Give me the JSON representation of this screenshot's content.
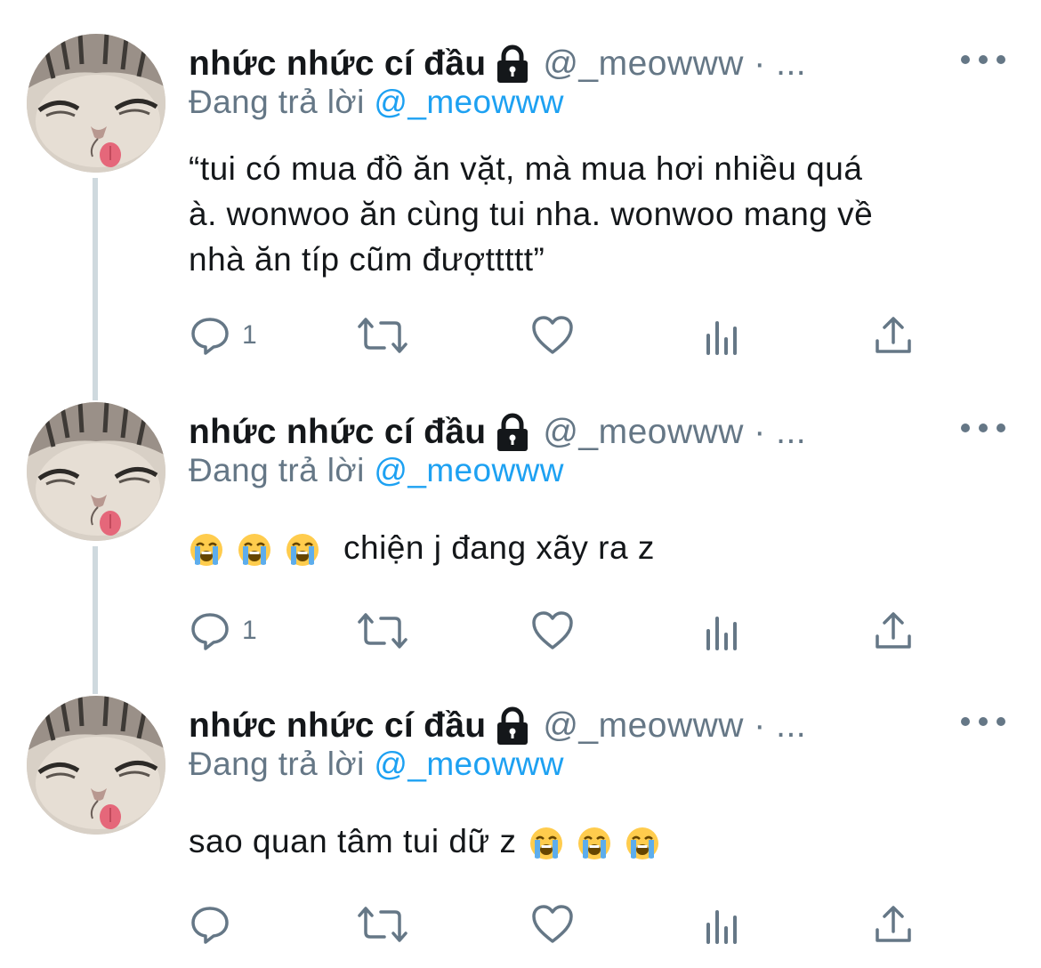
{
  "tweets": [
    {
      "display_name": "nhức nhức cí đầu",
      "handle": "@_meowww · ...",
      "replying_prefix": "Đang trả lời",
      "replying_to": "@_meowww",
      "text_lines": [
        "“tui có mua đồ ăn vặt, mà mua hơi nhiều quá",
        "à. wonwoo ăn cùng tui nha. wonwoo mang về",
        "nhà ăn típ cũm đượttttt”"
      ],
      "reply_count": "1"
    },
    {
      "display_name": "nhức nhức cí đầu",
      "handle": "@_meowww · ...",
      "replying_prefix": "Đang trả lời",
      "replying_to": "@_meowww",
      "text": "chiện j đang xãy ra z",
      "emojis": [
        "loudly-crying-face",
        "loudly-crying-face",
        "loudly-crying-face"
      ],
      "reply_count": "1"
    },
    {
      "display_name": "nhức nhức cí đầu",
      "handle": "@_meowww · ...",
      "replying_prefix": "Đang trả lời",
      "replying_to": "@_meowww",
      "text": "sao quan tâm tui dữ z",
      "emojis": [
        "loudly-crying-face",
        "loudly-crying-face",
        "loudly-crying-face"
      ],
      "reply_count": ""
    }
  ],
  "icons": {
    "lock": "lock-icon",
    "more": "more-icon",
    "reply": "reply-icon",
    "retweet": "retweet-icon",
    "like": "like-icon",
    "analytics": "analytics-icon",
    "share": "share-icon"
  },
  "colors": {
    "text": "#14171a",
    "secondary": "#657786",
    "mention": "#1da1f2",
    "thread_line": "#cfd9de"
  }
}
